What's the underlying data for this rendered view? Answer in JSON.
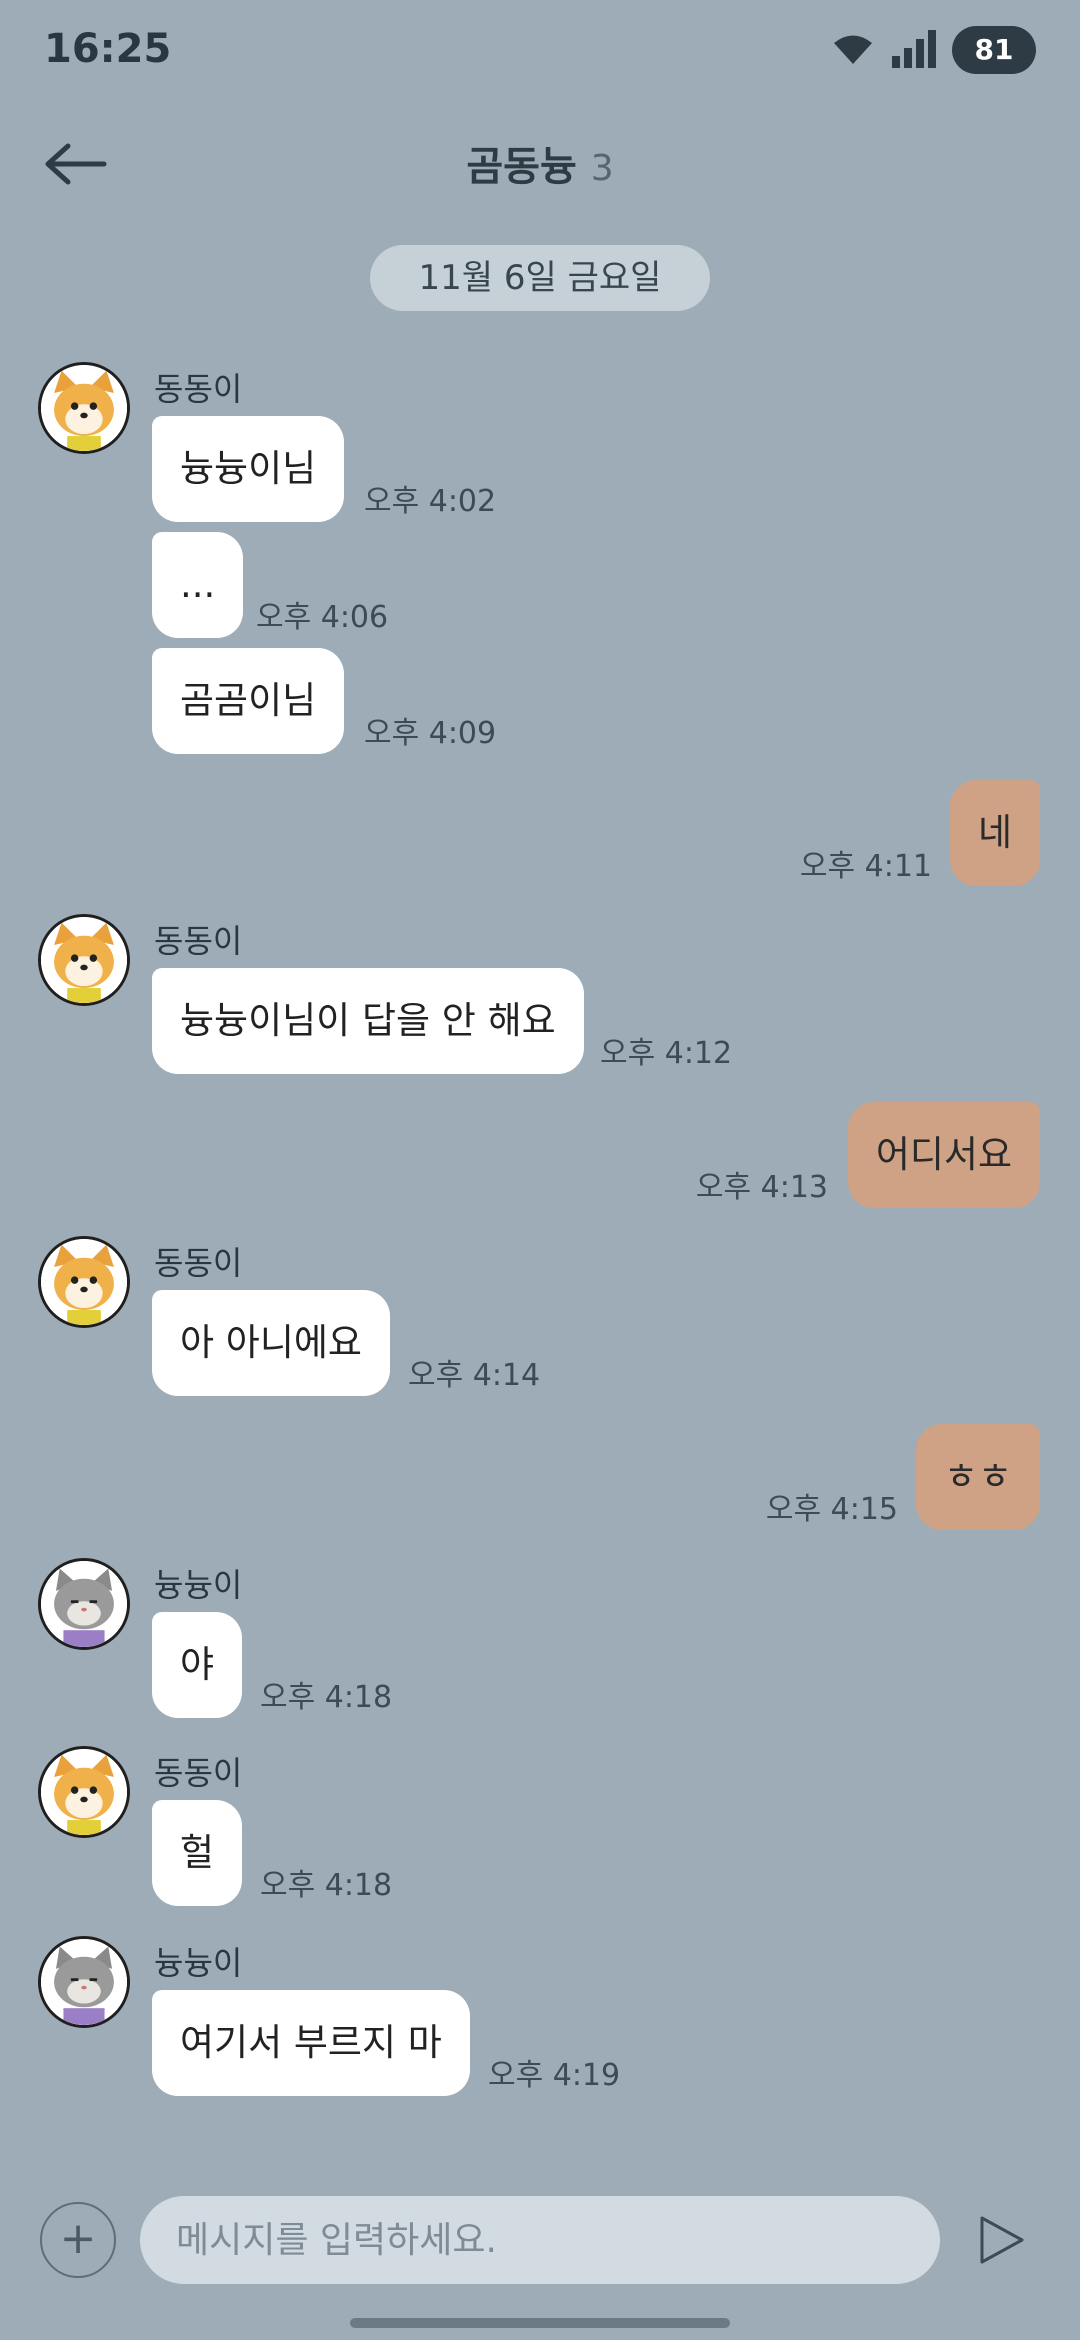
{
  "status_bar": {
    "time": "16:25",
    "battery": "81"
  },
  "header": {
    "title": "곰동늉",
    "member_count": "3"
  },
  "date_divider": "11월 6일 금요일",
  "senders": {
    "dongdong": "동동이",
    "nyungnyung": "늉늉이"
  },
  "messages": [
    {
      "text": "늉늉이님",
      "time": "오후 4:02"
    },
    {
      "text": "...",
      "time": "오후 4:06"
    },
    {
      "text": "곰곰이님",
      "time": "오후 4:09"
    },
    {
      "text": "네",
      "time": "오후 4:11"
    },
    {
      "text": "늉늉이님이 답을 안 해요",
      "time": "오후 4:12"
    },
    {
      "text": "어디서요",
      "time": "오후 4:13"
    },
    {
      "text": "아 아니에요",
      "time": "오후 4:14"
    },
    {
      "text": "ㅎㅎ",
      "time": "오후 4:15"
    },
    {
      "text": "야",
      "time": "오후 4:18"
    },
    {
      "text": "헐",
      "time": "오후 4:18"
    },
    {
      "text": "여기서 부르지 마",
      "time": "오후 4:19"
    }
  ],
  "composer": {
    "plus_icon": "+",
    "placeholder": "메시지를 입력하세요."
  },
  "icons": {
    "back": "arrow-left-icon",
    "wifi": "wifi-icon",
    "signal": "signal-icon",
    "send": "send-icon",
    "avatar_dog": "dog-avatar",
    "avatar_cat": "cat-avatar"
  },
  "colors": {
    "background": "#9dacb6",
    "incoming_bubble": "#ffffff",
    "outgoing_bubble": "#cfa285",
    "input_background": "#d2dbe2"
  }
}
